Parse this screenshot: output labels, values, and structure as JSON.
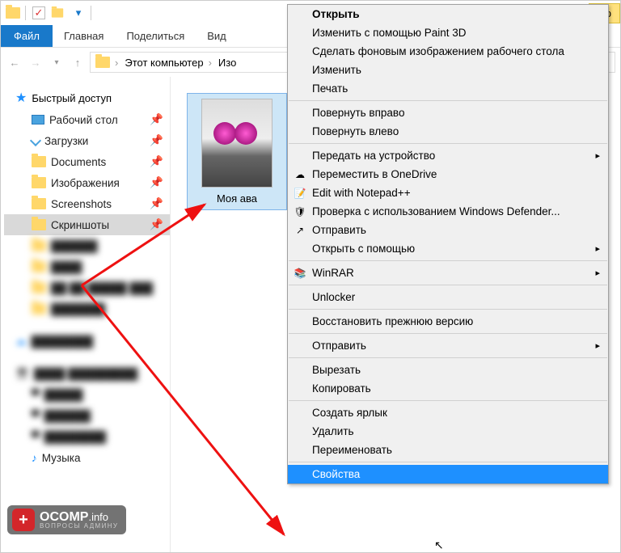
{
  "titlebar": {
    "tab_text": "Ср"
  },
  "ribbon": {
    "file": "Файл",
    "tab_home": "Главная",
    "tab_share": "Поделиться",
    "tab_view": "Вид"
  },
  "breadcrumb": {
    "root": "Этот компьютер",
    "segment2": "Изо"
  },
  "tree": {
    "quick_access": "Быстрый доступ",
    "items": [
      {
        "label": "Рабочий стол"
      },
      {
        "label": "Загрузки"
      },
      {
        "label": "Documents"
      },
      {
        "label": "Изображения"
      },
      {
        "label": "Screenshots"
      },
      {
        "label": "Скриншоты"
      }
    ],
    "music": "Музыка"
  },
  "thumbnail": {
    "label": "Моя ава"
  },
  "context_menu": {
    "groups": [
      [
        {
          "label": "Открыть",
          "bold": true
        },
        {
          "label": "Изменить с помощью Paint 3D"
        },
        {
          "label": "Сделать фоновым изображением рабочего стола"
        },
        {
          "label": "Изменить"
        },
        {
          "label": "Печать"
        }
      ],
      [
        {
          "label": "Повернуть вправо"
        },
        {
          "label": "Повернуть влево"
        }
      ],
      [
        {
          "label": "Передать на устройство",
          "sub": true
        },
        {
          "label": "Переместить в OneDrive",
          "icon": "onedrive"
        },
        {
          "label": "Edit with Notepad++",
          "icon": "notepad"
        },
        {
          "label": "Проверка с использованием Windows Defender...",
          "icon": "defender"
        },
        {
          "label": "Отправить",
          "icon": "share"
        },
        {
          "label": "Открыть с помощью",
          "sub": true
        }
      ],
      [
        {
          "label": "WinRAR",
          "icon": "winrar",
          "sub": true
        }
      ],
      [
        {
          "label": "Unlocker"
        }
      ],
      [
        {
          "label": "Восстановить прежнюю версию"
        }
      ],
      [
        {
          "label": "Отправить",
          "sub": true
        }
      ],
      [
        {
          "label": "Вырезать"
        },
        {
          "label": "Копировать"
        }
      ],
      [
        {
          "label": "Создать ярлык"
        },
        {
          "label": "Удалить"
        },
        {
          "label": "Переименовать"
        }
      ],
      [
        {
          "label": "Свойства",
          "highlight": true
        }
      ]
    ]
  },
  "watermark": {
    "brand": "OCOMP",
    "tld": ".info",
    "subtitle": "ВОПРОСЫ АДМИНУ",
    "badge": "+"
  }
}
